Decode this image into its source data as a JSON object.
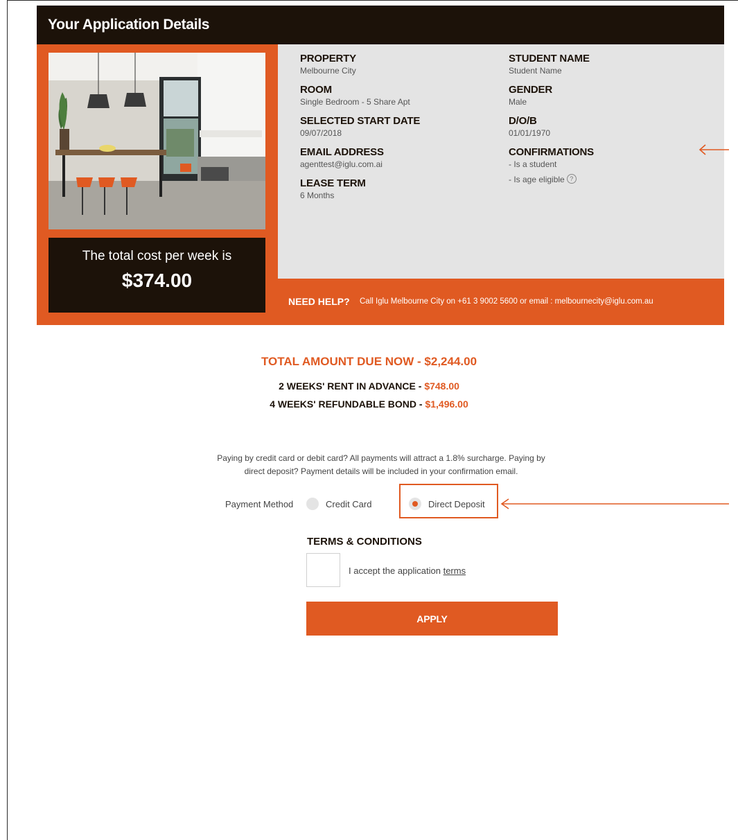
{
  "header": {
    "title": "Your Application Details"
  },
  "cost": {
    "label": "The total cost per week is",
    "value": "$374.00"
  },
  "details": {
    "left": [
      {
        "label": "PROPERTY",
        "value": "Melbourne City"
      },
      {
        "label": "ROOM",
        "value": "Single Bedroom - 5 Share Apt"
      },
      {
        "label": "SELECTED START DATE",
        "value": "09/07/2018"
      },
      {
        "label": "EMAIL ADDRESS",
        "value": "agenttest@iglu.com.ai"
      },
      {
        "label": "LEASE TERM",
        "value": "6 Months"
      }
    ],
    "right": [
      {
        "label": "STUDENT NAME",
        "value": "Student Name"
      },
      {
        "label": "GENDER",
        "value": "Male"
      },
      {
        "label": "D/O/B",
        "value": "01/01/1970"
      }
    ],
    "confirmations": {
      "label": "CONFIRMATIONS",
      "item1": "- Is a student",
      "item2": "- Is age eligible",
      "help_glyph": "?"
    }
  },
  "help": {
    "label": "NEED HELP?",
    "text": "Call Iglu Melbourne City on +61 3 9002 5600 or email : melbournecity@iglu.com.au"
  },
  "totals": {
    "title": "TOTAL AMOUNT DUE NOW - $2,244.00",
    "rent_label": "2 WEEKS' RENT IN ADVANCE - ",
    "rent_amount": "$748.00",
    "bond_label": "4 WEEKS' REFUNDABLE BOND - ",
    "bond_amount": "$1,496.00"
  },
  "notice": {
    "line1": "Paying by credit card or debit card? All payments will attract a 1.8% surcharge. Paying by",
    "line2": "direct deposit? Payment details will be included in your confirmation email."
  },
  "payment": {
    "label": "Payment Method",
    "options": [
      {
        "label": "Credit Card",
        "selected": false
      },
      {
        "label": "Direct Deposit",
        "selected": true
      }
    ]
  },
  "terms": {
    "title": "TERMS & CONDITIONS",
    "accept_text": "I accept the application ",
    "link_text": "terms"
  },
  "apply": {
    "label": "APPLY"
  },
  "colors": {
    "accent": "#e05a22",
    "dark": "#1c1209",
    "panel": "#e4e4e4"
  }
}
